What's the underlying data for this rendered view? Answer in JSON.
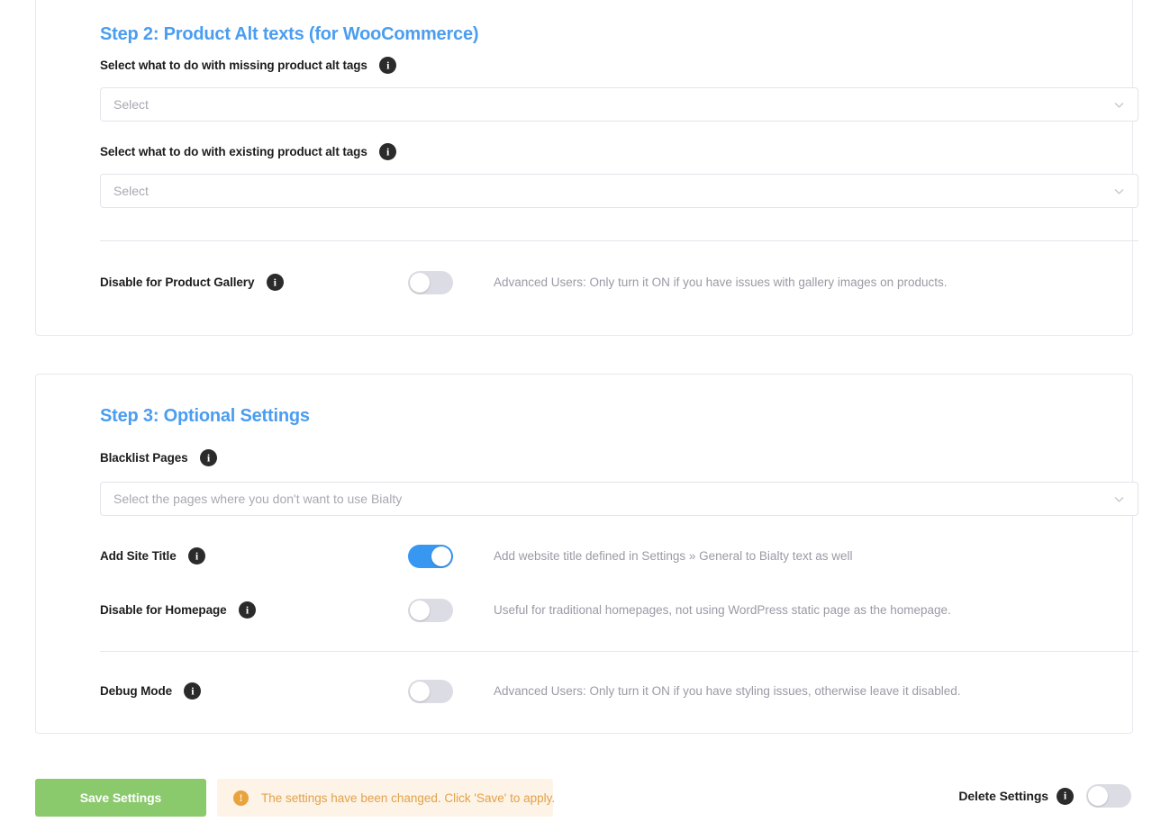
{
  "step2": {
    "title": "Step 2: Product Alt texts (for WooCommerce)",
    "fields": [
      {
        "label": "Select what to do with missing product alt tags",
        "info_icon": "info-icon",
        "select_placeholder": "Select",
        "chevron_icon": "chevron-down-icon"
      },
      {
        "label": "Select what to do with existing product alt tags",
        "info_icon": "info-icon",
        "select_placeholder": "Select",
        "chevron_icon": "chevron-down-icon"
      }
    ],
    "toggles": [
      {
        "label": "Disable for Product Gallery",
        "info_icon": "info-icon",
        "state": "off",
        "helper": "Advanced Users: Only turn it ON if you have issues with gallery images on products."
      }
    ]
  },
  "step3": {
    "title": "Step 3: Optional Settings",
    "blacklist": {
      "label": "Blacklist Pages",
      "info_icon": "info-icon",
      "select_placeholder": "Select the pages where you don't want to use Bialty",
      "chevron_icon": "chevron-down-icon"
    },
    "toggles": [
      {
        "label": "Add Site Title",
        "info_icon": "info-icon",
        "state": "on",
        "helper": "Add website title defined in Settings » General to Bialty text as well"
      },
      {
        "label": "Disable for Homepage",
        "info_icon": "info-icon",
        "state": "off",
        "helper": "Useful for traditional homepages, not using WordPress static page as the homepage."
      },
      {
        "label": "Debug Mode",
        "info_icon": "info-icon",
        "state": "off",
        "helper": "Advanced Users: Only turn it ON if you have styling issues, otherwise leave it disabled."
      }
    ]
  },
  "footer": {
    "save_label": "Save Settings",
    "notice_icon": "exclamation-circle-icon",
    "notice_text": "The settings have been changed. Click 'Save' to apply.",
    "delete_label": "Delete Settings",
    "delete_info_icon": "info-icon",
    "delete_state": "off"
  },
  "colors": {
    "heading_blue": "#4a9df0",
    "toggle_on": "#3897f0",
    "toggle_off": "#dcdce4",
    "save_green": "#8bc96d",
    "notice_bg": "#fdf3e6",
    "notice_text": "#e2a24a",
    "info_dark": "#2b2b2b",
    "helper_gray": "#9a9aa6",
    "card_border": "#e8e8ef"
  },
  "glyphs": {
    "info": "i",
    "warn": "!"
  }
}
